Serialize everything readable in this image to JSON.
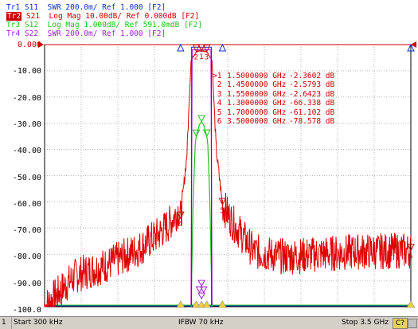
{
  "traces": [
    {
      "id": "Tr1",
      "text": "S11  SWR 200.0m/ Ref 1.000 [F2]",
      "color": "#1030d0",
      "active": false
    },
    {
      "id": "Tr2",
      "text": "S21  Log Mag 10.00dB/ Ref 0.000dB [F2]",
      "color": "#cc0000",
      "active": true
    },
    {
      "id": "Tr3",
      "text": "S12  Log Mag 1.000dB/ Ref 591.0mdB [F2]",
      "color": "#20c020",
      "active": false
    },
    {
      "id": "Tr4",
      "text": "S22  SWR 200.0m/ Ref 1.000 [F2]",
      "color": "#a020d0",
      "active": false
    }
  ],
  "y_axis": {
    "labels": [
      "0.000",
      "-10.00",
      "-20.00",
      "-30.00",
      "-40.00",
      "-50.00",
      "-60.00",
      "-70.00",
      "-80.00",
      "-90.00",
      "-100.0"
    ]
  },
  "markers": [
    {
      "id": "1",
      "freq": "1.5000000 GHz",
      "value": "-2.3602 dB",
      "active": true
    },
    {
      "id": "2",
      "freq": "1.4500000 GHz",
      "value": "-2.5793 dB",
      "active": false
    },
    {
      "id": "3",
      "freq": "1.5500000 GHz",
      "value": "-2.6423 dB",
      "active": false
    },
    {
      "id": "4",
      "freq": "1.3000000 GHz",
      "value": "-66.338 dB",
      "active": false
    },
    {
      "id": "5",
      "freq": "1.7000000 GHz",
      "value": "-61.102 dB",
      "active": false
    },
    {
      "id": "6",
      "freq": "3.5000000 GHz",
      "value": "-78.578 dB",
      "active": false
    }
  ],
  "chart_data": {
    "type": "line",
    "x_range_ghz": [
      0.0003,
      3.5
    ],
    "ylim": [
      -100,
      0
    ],
    "ref_level_db": 0,
    "grid": true,
    "series": [
      {
        "name": "Tr2",
        "color": "#cc0000",
        "x": [
          0.0003,
          0.3,
          0.6,
          0.9,
          1.1,
          1.2,
          1.28,
          1.3,
          1.36,
          1.4,
          1.45,
          1.5,
          1.55,
          1.6,
          1.64,
          1.7,
          1.8,
          2.0,
          2.3,
          2.6,
          3.0,
          3.5
        ],
        "y": [
          -100,
          -88,
          -84,
          -78,
          -72,
          -68,
          -63,
          -66.3,
          -42,
          -6,
          -2.6,
          -2.4,
          -2.6,
          -6,
          -40,
          -61.1,
          -68,
          -79,
          -81,
          -80,
          -79,
          -78.6
        ]
      },
      {
        "name": "Tr3",
        "color": "#20c020",
        "x": [
          1.4,
          1.42,
          1.44,
          1.45,
          1.48,
          1.5,
          1.52,
          1.55,
          1.56,
          1.58,
          1.6
        ],
        "y": [
          -100,
          -60,
          -38,
          -35,
          -30.5,
          -29.5,
          -30.5,
          -35,
          -38,
          -60,
          -100
        ]
      }
    ]
  },
  "status_bar": {
    "channel": "1",
    "start": "Start 300 kHz",
    "ifbw": "IFBW 70 kHz",
    "stop": "Stop 3.5 GHz",
    "cal_flag": "C?"
  }
}
